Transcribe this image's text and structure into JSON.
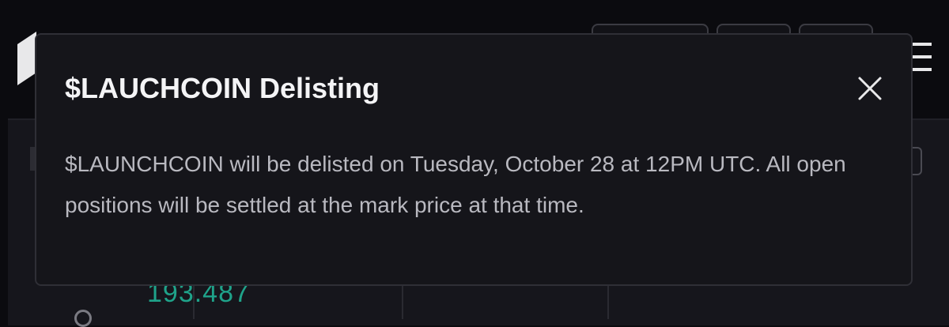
{
  "background": {
    "price_value": "193.487"
  },
  "modal": {
    "title": "$LAUCHCOIN Delisting",
    "body": "$LAUNCHCOIN will be delisted on Tuesday, October 28 at 12PM UTC. All open positions will be settled at the mark price at that time.",
    "close_icon": "close-icon"
  },
  "colors": {
    "modal_bg": "#15151a",
    "modal_border": "#2f2f36",
    "title": "#f4f4f6",
    "body": "#b9b9c0",
    "price_green": "#1fa38a"
  }
}
